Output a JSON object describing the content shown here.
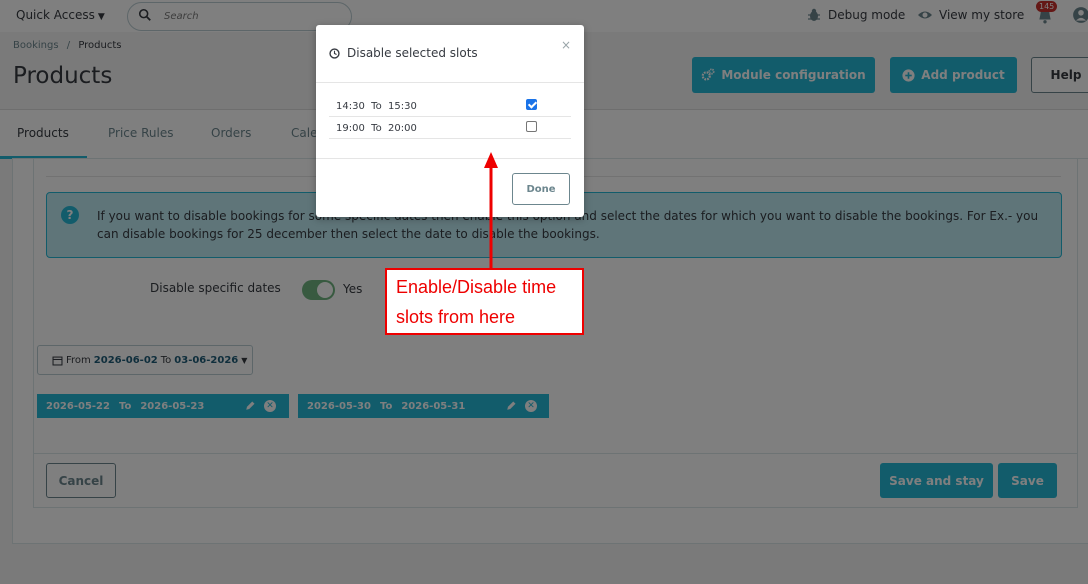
{
  "header": {
    "quick_access": "Quick Access",
    "search_placeholder": "Search",
    "debug_mode": "Debug mode",
    "view_store": "View my store",
    "notifications_count": "145"
  },
  "breadcrumb": {
    "parent": "Bookings",
    "separator": "/",
    "current": "Products"
  },
  "page_title": "Products",
  "toolbar": {
    "module_config": "Module configuration",
    "add_product": "Add product",
    "help": "Help"
  },
  "tabs": [
    {
      "label": "Products"
    },
    {
      "label": "Price Rules"
    },
    {
      "label": "Orders"
    },
    {
      "label": "Cale"
    }
  ],
  "info": {
    "text": "If you want to disable bookings for some specific dates then enable this option and select the dates for which you want to disable the bookings. For Ex.- you can disable bookings for 25 december then select the date to disable the bookings."
  },
  "disable_dates": {
    "label": "Disable specific dates",
    "value": "Yes"
  },
  "date_filter": {
    "from_label": "From",
    "from": "2026-06-02",
    "to_label": "To",
    "to": "03-06-2026"
  },
  "date_ranges": [
    {
      "from": "2026-05-22",
      "to_label": "To",
      "to": "2026-05-23"
    },
    {
      "from": "2026-05-30",
      "to_label": "To",
      "to": "2026-05-31"
    }
  ],
  "form_actions": {
    "cancel": "Cancel",
    "save_and_stay": "Save and stay",
    "save": "Save"
  },
  "modal": {
    "title": "Disable selected slots",
    "close": "×",
    "slots": [
      {
        "label": "14:30  To  15:30",
        "checked": true
      },
      {
        "label": "19:00  To  20:00",
        "checked": false
      }
    ],
    "done": "Done"
  },
  "annotation": {
    "line1": "Enable/Disable time",
    "line2": "slots from here"
  },
  "colors": {
    "primary": "#25b9d7",
    "switch_on": "#70b580",
    "annotation": "#ee0000"
  }
}
